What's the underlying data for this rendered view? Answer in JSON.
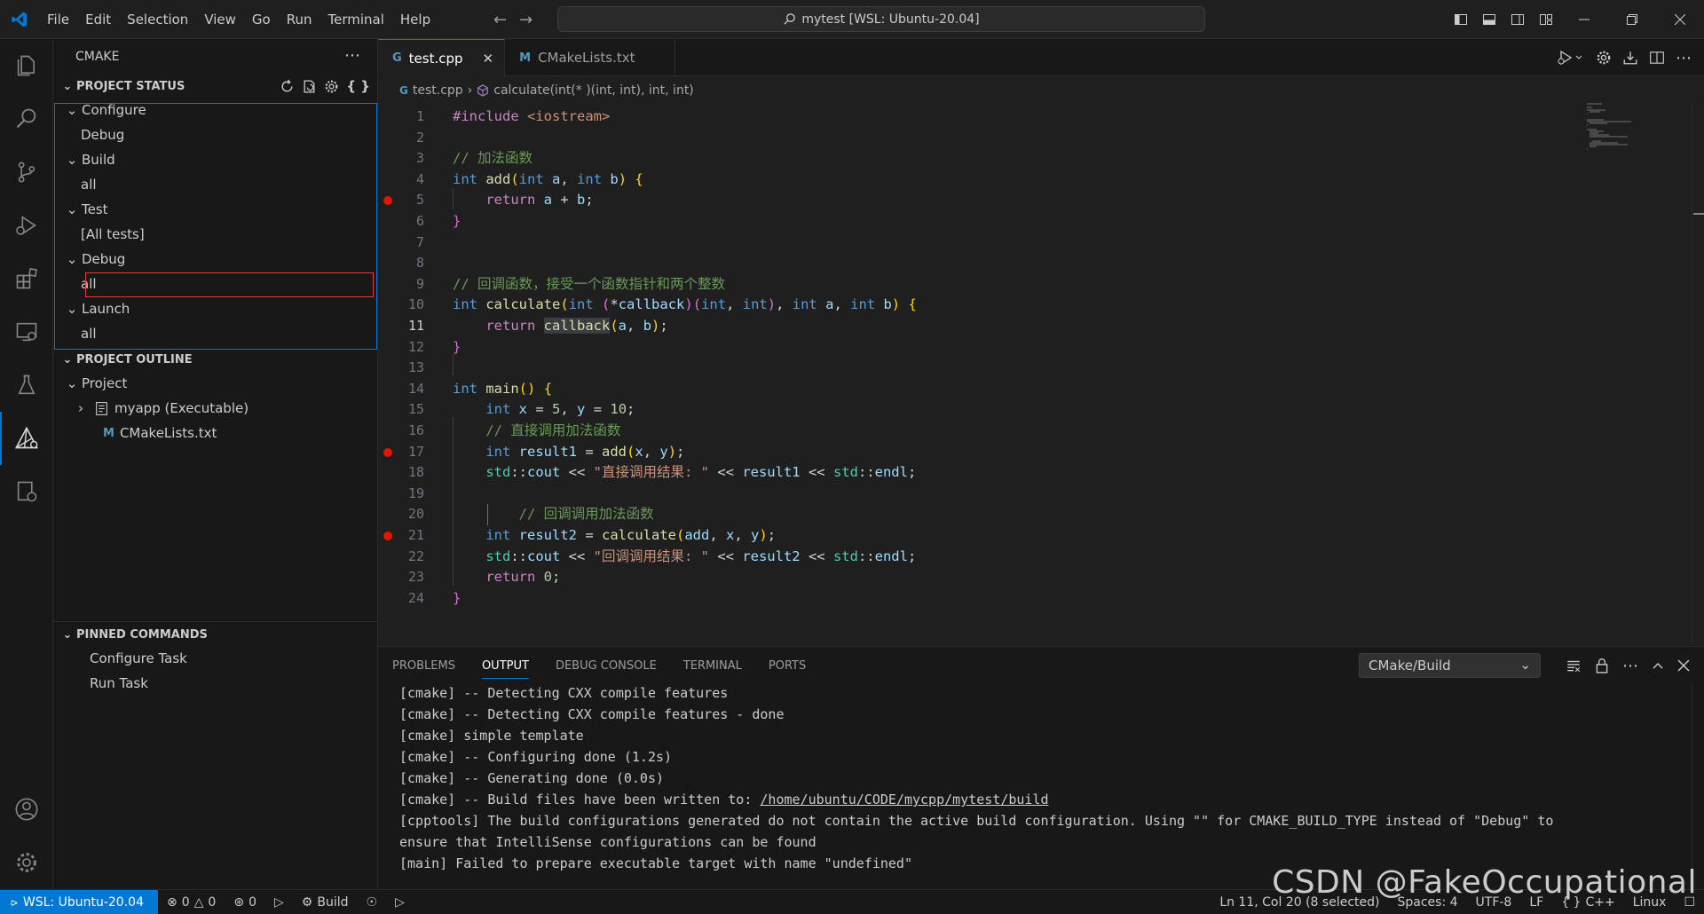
{
  "window": {
    "title": "mytest [WSL: Ubuntu-20.04]",
    "menus": [
      "File",
      "Edit",
      "Selection",
      "View",
      "Go",
      "Run",
      "Terminal",
      "Help"
    ]
  },
  "sidebar": {
    "title": "CMAKE",
    "project_status": {
      "header": "PROJECT STATUS",
      "groups": [
        {
          "label": "Configure",
          "child": "Debug"
        },
        {
          "label": "Build",
          "child": "all"
        },
        {
          "label": "Test",
          "child": "[All tests]"
        },
        {
          "label": "Debug",
          "child": "all"
        },
        {
          "label": "Launch",
          "child": "all"
        }
      ]
    },
    "project_outline": {
      "header": "PROJECT OUTLINE",
      "project": "Project",
      "executable": "myapp (Executable)",
      "cmakelists": "CMakeLists.txt"
    },
    "pinned_commands": {
      "header": "PINNED COMMANDS",
      "items": [
        "Configure Task",
        "Run Task"
      ]
    }
  },
  "editor": {
    "tabs": [
      {
        "label": "test.cpp",
        "active": true
      },
      {
        "label": "CMakeLists.txt",
        "active": false
      }
    ],
    "breadcrumb": {
      "file": "test.cpp",
      "symbol": "calculate(int(* )(int, int), int, int)"
    },
    "current_line": 11,
    "breakpoints": [
      5,
      17,
      21
    ],
    "lines": [
      "#include <iostream>",
      "",
      "// 加法函数",
      "int add(int a, int b) {",
      "    return a + b;",
      "}",
      "",
      "",
      "// 回调函数，接受一个函数指针和两个整数",
      "int calculate(int (*callback)(int, int), int a, int b) {",
      "    return callback(a, b);",
      "}",
      "",
      "int main() {",
      "    int x = 5, y = 10;",
      "    // 直接调用加法函数",
      "    int result1 = add(x, y);",
      "    std::cout << \"直接调用结果: \" << result1 << std::endl;",
      "",
      "        // 回调调用加法函数",
      "    int result2 = calculate(add, x, y);",
      "    std::cout << \"回调调用结果: \" << result2 << std::endl;",
      "    return 0;",
      "}"
    ]
  },
  "panel": {
    "tabs": [
      "PROBLEMS",
      "OUTPUT",
      "DEBUG CONSOLE",
      "TERMINAL",
      "PORTS"
    ],
    "active_tab": "OUTPUT",
    "selected_channel": "CMake/Build",
    "output_lines": [
      "[cmake] -- Detecting CXX compile features",
      "[cmake] -- Detecting CXX compile features - done",
      "[cmake] simple template",
      "[cmake] -- Configuring done (1.2s)",
      "[cmake] -- Generating done (0.0s)",
      "[cmake] -- Build files have been written to: ",
      "[cpptools] The build configurations generated do not contain the active build configuration. Using \"\" for CMAKE_BUILD_TYPE instead of \"Debug\" to",
      "ensure that IntelliSense configurations can be found",
      "[main] Failed to prepare executable target with name \"undefined\""
    ],
    "build_path_link": "/home/ubuntu/CODE/mycpp/mytest/build"
  },
  "statusbar": {
    "remote": "WSL: Ubuntu-20.04",
    "errors": "0",
    "warnings": "0",
    "ports": "0",
    "build": "Build",
    "position": "Ln 11, Col 20 (8 selected)",
    "spaces": "Spaces: 4",
    "encoding": "UTF-8",
    "eol": "LF",
    "language": "C++",
    "platform": "Linux"
  },
  "watermark": "CSDN @FakeOccupational",
  "colors": {
    "accent": "#0078d4",
    "breakpoint": "#e51400",
    "selection_border": "#e03a3a"
  }
}
